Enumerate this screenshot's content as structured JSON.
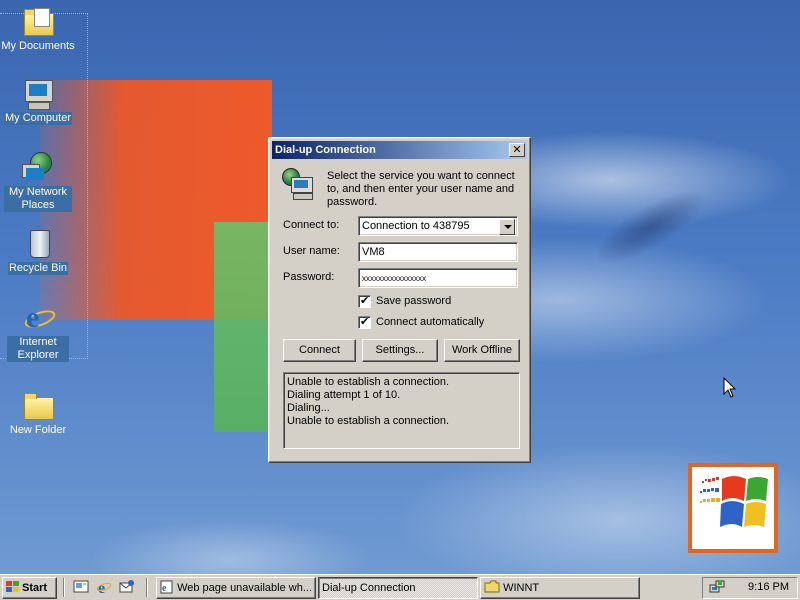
{
  "desktop": {
    "icons": [
      {
        "label": "My Documents",
        "icon": "my-documents-icon"
      },
      {
        "label": "My Computer",
        "icon": "my-computer-icon"
      },
      {
        "label": "My Network Places",
        "icon": "network-places-icon"
      },
      {
        "label": "Recycle Bin",
        "icon": "recycle-bin-icon"
      },
      {
        "label": "Internet Explorer",
        "icon": "internet-explorer-icon"
      },
      {
        "label": "New Folder",
        "icon": "folder-icon"
      }
    ]
  },
  "dialog": {
    "title": "Dial-up Connection",
    "close_label": "✕",
    "intro": "Select the service you want to connect to, and then enter your user name and password.",
    "connect_to_label": "Connect to:",
    "connect_to_value": "Connection to 438795",
    "username_label": "User name:",
    "username_value": "VM8",
    "password_label": "Password:",
    "password_value": "xxxxxxxxxxxxxxxx",
    "save_password_label": "Save password",
    "save_password_checked": true,
    "connect_auto_label": "Connect automatically",
    "connect_auto_checked": true,
    "buttons": {
      "connect": "Connect",
      "settings": "Settings...",
      "work_offline": "Work Offline"
    },
    "status_log": [
      "Unable to establish a connection.",
      "Dialing attempt 1 of 10.",
      "Dialing...",
      "Unable to establish a connection."
    ]
  },
  "taskbar": {
    "start_label": "Start",
    "tasks": [
      {
        "label": "Web page unavailable wh...",
        "icon": "ie-page-icon",
        "active": false
      },
      {
        "label": "Dial-up Connection",
        "icon": "",
        "active": true
      },
      {
        "label": "WINNT",
        "icon": "folder-icon",
        "active": false
      }
    ],
    "clock": "9:16 PM"
  },
  "colors": {
    "titlebar_start": "#0a246a",
    "titlebar_end": "#a6caf0",
    "desktop_blue": "#3a66b0",
    "logo_orange": "#e2661e"
  }
}
